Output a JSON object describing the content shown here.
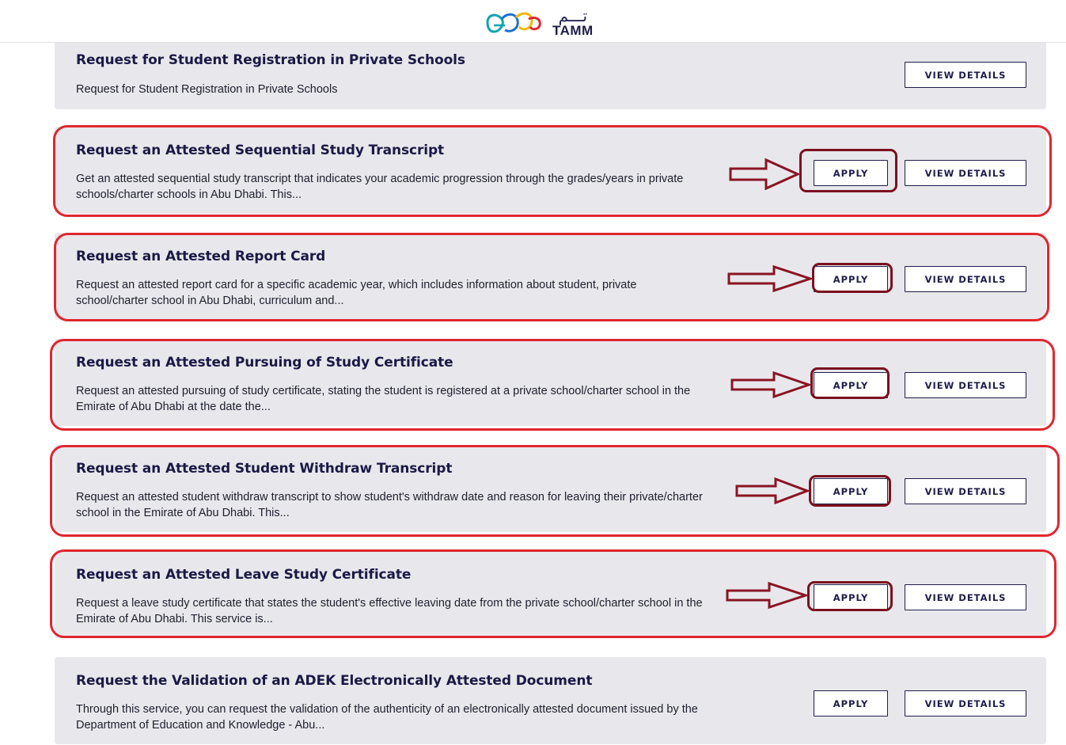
{
  "header": {
    "logo_arabic": "تـــم",
    "logo_english": "TAMM"
  },
  "services": [
    {
      "title": "Request for Student Registration in Private Schools",
      "description": "Request for Student Registration in Private Schools",
      "apply_label": null,
      "view_label": "VIEW DETAILS",
      "highlighted": false
    },
    {
      "title": "Request an Attested Sequential Study Transcript",
      "description": "Get an attested sequential study transcript that indicates your academic progression through the grades/years in private schools/charter schools in Abu Dhabi. This...",
      "apply_label": "APPLY",
      "view_label": "VIEW DETAILS",
      "highlighted": true
    },
    {
      "title": "Request an Attested Report Card",
      "description": "Request an attested report card for a specific academic year, which includes information about student, private school/charter school in Abu Dhabi, curriculum and...",
      "apply_label": "APPLY",
      "view_label": "VIEW DETAILS",
      "highlighted": true
    },
    {
      "title": "Request an Attested Pursuing of Study Certificate",
      "description": "Request an attested pursuing of study certificate, stating the student is registered at a private school/charter school in the Emirate of Abu Dhabi at the date the...",
      "apply_label": "APPLY",
      "view_label": "VIEW DETAILS",
      "highlighted": true
    },
    {
      "title": "Request an Attested Student Withdraw Transcript",
      "description": "Request an attested student withdraw transcript to show student's withdraw date and reason for leaving their private/charter school in the Emirate of Abu Dhabi. This...",
      "apply_label": "APPLY",
      "view_label": "VIEW DETAILS",
      "highlighted": true
    },
    {
      "title": "Request an Attested Leave Study Certificate",
      "description": "Request a leave study certificate that states the student's effective leaving date from the private school/charter school in the Emirate of Abu Dhabi. This service is...",
      "apply_label": "APPLY",
      "view_label": "VIEW DETAILS",
      "highlighted": true
    },
    {
      "title": "Request the Validation of an ADEK Electronically Attested Document",
      "description": "Through this service, you can request the validation of the authenticity of an electronically attested document issued by the Department of Education and Knowledge - Abu...",
      "apply_label": "APPLY",
      "view_label": "VIEW DETAILS",
      "highlighted": false
    }
  ],
  "colors": {
    "card_background": "#e8e8ec",
    "title_text": "#1a1946",
    "annotation_box": "#e0262f",
    "annotation_apply": "#7b1020"
  },
  "icons": {
    "logo": "tamm-logo-icon",
    "annotation_arrow": "right-arrow-icon"
  }
}
